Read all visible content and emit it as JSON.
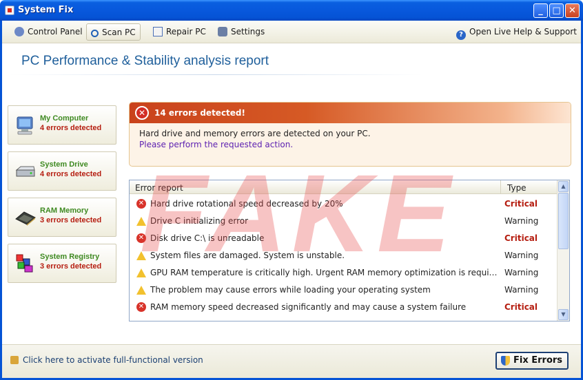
{
  "window": {
    "title": "System Fix"
  },
  "toolbar": {
    "control_panel": "Control Panel",
    "scan_pc": "Scan PC",
    "repair_pc": "Repair PC",
    "settings": "Settings",
    "help": "Open Live Help & Support"
  },
  "main": {
    "heading": "PC Performance & Stability analysis report"
  },
  "sidebar": {
    "items": [
      {
        "name": "My Computer",
        "errors": "4 errors detected",
        "icon": "computer-icon"
      },
      {
        "name": "System Drive",
        "errors": "4 errors detected",
        "icon": "drive-icon"
      },
      {
        "name": "RAM Memory",
        "errors": "3 errors detected",
        "icon": "ram-icon"
      },
      {
        "name": "System Registry",
        "errors": "3 errors detected",
        "icon": "registry-icon"
      }
    ]
  },
  "alert": {
    "title": "14 errors detected!",
    "line1": "Hard drive and memory errors are detected on your PC.",
    "line2": "Please perform the requested action."
  },
  "list": {
    "col_report": "Error report",
    "col_type": "Type",
    "rows": [
      {
        "text": "Hard drive rotational speed decreased by 20%",
        "type": "Critical"
      },
      {
        "text": "Drive C initializing error",
        "type": "Warning"
      },
      {
        "text": "Disk drive C:\\ is unreadable",
        "type": "Critical"
      },
      {
        "text": "System files are damaged. System is unstable.",
        "type": "Warning"
      },
      {
        "text": "GPU RAM temperature is critically high. Urgent RAM memory optimization is required to prevent system failure",
        "type": "Warning"
      },
      {
        "text": "The problem may cause errors while loading your operating system",
        "type": "Warning"
      },
      {
        "text": "RAM memory speed decreased significantly and may cause a system failure",
        "type": "Critical"
      }
    ]
  },
  "watermark": "FAKE",
  "footer": {
    "activate": "Click here to activate full-functional version",
    "fix_button": "Fix Errors"
  },
  "colors": {
    "accent": "#0553d5",
    "critical": "#b51d10",
    "green": "#3f8a22",
    "watermark": "#e74646"
  }
}
